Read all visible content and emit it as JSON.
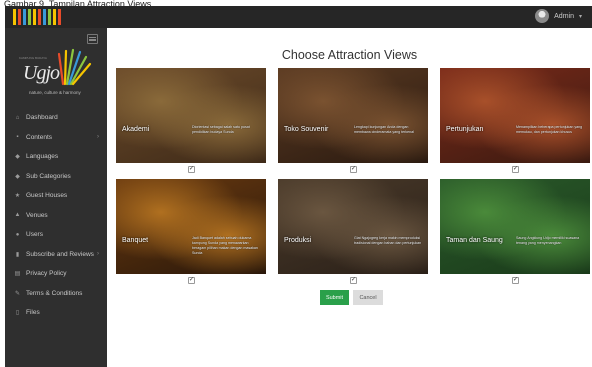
{
  "caption": "Gambar 9. Tampilan Attraction Views",
  "header": {
    "logo_colors": [
      "#f5c400",
      "#e84b2a",
      "#3a9ad9",
      "#8cc63f",
      "#f5c400",
      "#e84b2a",
      "#3a9ad9",
      "#8cc63f",
      "#f5c400",
      "#e84b2a"
    ],
    "user_name": "Admin"
  },
  "brand": {
    "pretitle": "KAMPUNG BUDAYA",
    "name": "Ugjo",
    "tagline": "nature, culture & harmony"
  },
  "sidebar": {
    "items": [
      {
        "label": "Dashboard",
        "icon": "home-icon",
        "glyph": "⌂",
        "arrow": ""
      },
      {
        "label": "Contents",
        "icon": "folder-icon",
        "glyph": "▪",
        "arrow": "›"
      },
      {
        "label": "Languages",
        "icon": "tag-icon",
        "glyph": "◆",
        "arrow": ""
      },
      {
        "label": "Sub Categories",
        "icon": "tags-icon",
        "glyph": "◆",
        "arrow": ""
      },
      {
        "label": "Guest Houses",
        "icon": "star-icon",
        "glyph": "★",
        "arrow": ""
      },
      {
        "label": "Venues",
        "icon": "venue-icon",
        "glyph": "▲",
        "arrow": ""
      },
      {
        "label": "Users",
        "icon": "user-icon",
        "glyph": "●",
        "arrow": ""
      },
      {
        "label": "Subscribe and Reviews",
        "icon": "bookmark-icon",
        "glyph": "▮",
        "arrow": "›"
      },
      {
        "label": "Privacy Policy",
        "icon": "document-icon",
        "glyph": "▤",
        "arrow": ""
      },
      {
        "label": "Terms & Conditions",
        "icon": "pencil-icon",
        "glyph": "✎",
        "arrow": ""
      },
      {
        "label": "Files",
        "icon": "file-icon",
        "glyph": "▯",
        "arrow": ""
      }
    ]
  },
  "main": {
    "title": "Choose Attraction Views",
    "cards": [
      {
        "name": "Akademi",
        "desc": "Diorientasi sebagai salah satu pusat pendidikan budaya Sunda",
        "colors": [
          "#6b4a2a",
          "#3e2a18",
          "#8a6a3a"
        ],
        "checked": true
      },
      {
        "name": "Toko Souvenir",
        "desc": "Lengkapi kunjungan Anda dengan membawa cinderamata yang terkenal",
        "colors": [
          "#5a3a22",
          "#2a1a10",
          "#7a5230"
        ],
        "checked": true
      },
      {
        "name": "Pertunjukan",
        "desc": "Menampilkan beberapa pertunjukan yang memukau, dan pertunjukan khusus",
        "colors": [
          "#7a2a1a",
          "#3a1a10",
          "#a8502a"
        ],
        "checked": true
      },
      {
        "name": "Banquet",
        "desc": "Jadi Banquet adalah sebuah dukama kampung Sunda yang menawarkan beragam pilihan makan dengan masakan Sunda",
        "colors": [
          "#6a3a10",
          "#2a180a",
          "#b07020"
        ],
        "checked": true
      },
      {
        "name": "Produksi",
        "desc": "Giat Ngajogreg kerja makin memproduksi tradisional dengan bahan dan pertunjukan",
        "colors": [
          "#4a3a2a",
          "#2a2018",
          "#6a5640"
        ],
        "checked": true
      },
      {
        "name": "Taman dan Saung",
        "desc": "Saung Angklung Udjo memiliki suasana tenang yang menyenangkan",
        "colors": [
          "#2a5a2a",
          "#1a3a1a",
          "#4a8a3a"
        ],
        "checked": true
      }
    ],
    "submit_label": "Submit",
    "cancel_label": "Cancel"
  }
}
